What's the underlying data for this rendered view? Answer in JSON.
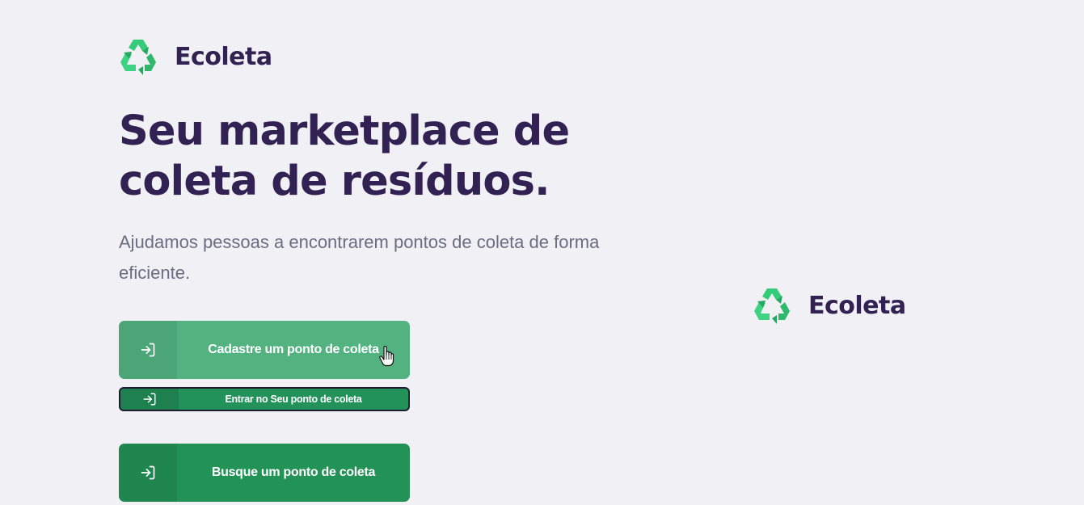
{
  "header": {
    "brand_name": "Ecoleta",
    "logo_icon": "recycle-icon"
  },
  "hero": {
    "title": "Seu marketplace de coleta de resíduos.",
    "subtitle": "Ajudamos pessoas a encontrarem pontos de coleta de forma eficiente."
  },
  "actions": {
    "register_label": "Cadastre um ponto de coleta",
    "enter_label": "Entrar no Seu ponto de coleta",
    "search_label": "Busque um ponto de coleta",
    "button_icon": "log-in-icon"
  },
  "side_logo": {
    "brand_name": "Ecoleta"
  },
  "colors": {
    "title": "#322153",
    "text": "#6c6c80",
    "background": "#f0f0f5",
    "primary": "#239256",
    "primary_hover": "#52b380",
    "logo_green": "#34cb79"
  }
}
